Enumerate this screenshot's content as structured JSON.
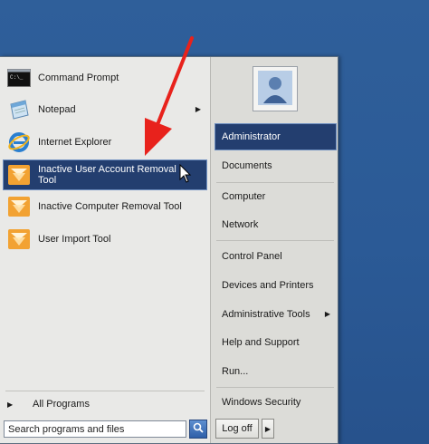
{
  "left_pane": {
    "programs": [
      {
        "label": "Command Prompt",
        "icon": "command-prompt-icon"
      },
      {
        "label": "Notepad",
        "icon": "notepad-icon",
        "has_submenu": true
      },
      {
        "label": "Internet Explorer",
        "icon": "internet-explorer-icon"
      },
      {
        "label_line1": "Inactive User Account Removal",
        "label_line2": "Tool",
        "icon": "tool-icon",
        "selected": true
      },
      {
        "label": "Inactive Computer Removal Tool",
        "icon": "tool-icon"
      },
      {
        "label": "User Import Tool",
        "icon": "tool-icon"
      }
    ],
    "all_programs": "All Programs",
    "search_placeholder": "Search programs and files"
  },
  "right_pane": {
    "items": [
      {
        "label": "Administrator",
        "selected": true
      },
      {
        "label": "Documents"
      },
      {
        "label": "Computer"
      },
      {
        "label": "Network"
      },
      {
        "label": "Control Panel"
      },
      {
        "label": "Devices and Printers"
      },
      {
        "label": "Administrative Tools",
        "has_submenu": true
      },
      {
        "label": "Help and Support"
      },
      {
        "label": "Run..."
      },
      {
        "label": "Windows Security"
      }
    ],
    "log_off": "Log off"
  },
  "colors": {
    "desktop": "#2b5a96",
    "selection": "#233e6f",
    "annotation_arrow": "#e8221c",
    "tool_icon": "#f2a232"
  }
}
